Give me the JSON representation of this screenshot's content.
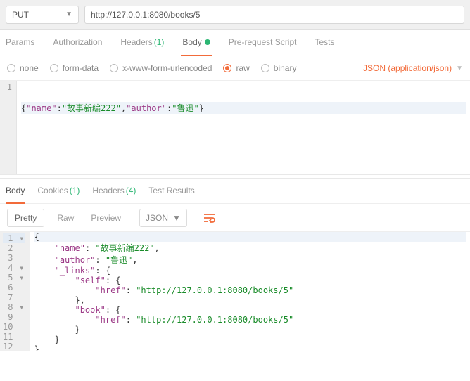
{
  "request": {
    "method": "PUT",
    "url": "http://127.0.0.1:8080/books/5"
  },
  "tabs": {
    "params": "Params",
    "authorization": "Authorization",
    "headers": "Headers",
    "headers_count": "(1)",
    "body": "Body",
    "prerequest": "Pre-request Script",
    "tests": "Tests"
  },
  "body_options": {
    "none": "none",
    "form_data": "form-data",
    "x_www": "x-www-form-urlencoded",
    "raw": "raw",
    "binary": "binary",
    "content_type": "JSON (application/json)"
  },
  "request_body": {
    "line1_gutter": "1",
    "parts": {
      "open": "{",
      "k1": "\"name\"",
      "c1": ":",
      "v1": "\"故事新编222\"",
      "comma": ",",
      "k2": "\"author\"",
      "c2": ":",
      "v2": "\"鲁迅\"",
      "close": "}"
    }
  },
  "response_tabs": {
    "body": "Body",
    "cookies": "Cookies",
    "cookies_count": "(1)",
    "headers": "Headers",
    "headers_count": "(4)",
    "test_results": "Test Results"
  },
  "response_toolbar": {
    "pretty": "Pretty",
    "raw": "Raw",
    "preview": "Preview",
    "format": "JSON"
  },
  "response_body": {
    "lines": [
      {
        "n": "1",
        "fold": "▾",
        "indent": 0,
        "tokens": [
          {
            "t": "p",
            "v": "{"
          }
        ]
      },
      {
        "n": "2",
        "indent": 1,
        "tokens": [
          {
            "t": "k",
            "v": "\"name\""
          },
          {
            "t": "p",
            "v": ": "
          },
          {
            "t": "s",
            "v": "\"故事新编222\""
          },
          {
            "t": "p",
            "v": ","
          }
        ]
      },
      {
        "n": "3",
        "indent": 1,
        "tokens": [
          {
            "t": "k",
            "v": "\"author\""
          },
          {
            "t": "p",
            "v": ": "
          },
          {
            "t": "s",
            "v": "\"鲁迅\""
          },
          {
            "t": "p",
            "v": ","
          }
        ]
      },
      {
        "n": "4",
        "fold": "▾",
        "indent": 1,
        "tokens": [
          {
            "t": "k",
            "v": "\"_links\""
          },
          {
            "t": "p",
            "v": ": {"
          }
        ]
      },
      {
        "n": "5",
        "fold": "▾",
        "indent": 2,
        "tokens": [
          {
            "t": "k",
            "v": "\"self\""
          },
          {
            "t": "p",
            "v": ": {"
          }
        ]
      },
      {
        "n": "6",
        "indent": 3,
        "tokens": [
          {
            "t": "k",
            "v": "\"href\""
          },
          {
            "t": "p",
            "v": ": "
          },
          {
            "t": "s",
            "v": "\"http://127.0.0.1:8080/books/5\""
          }
        ]
      },
      {
        "n": "7",
        "indent": 2,
        "tokens": [
          {
            "t": "p",
            "v": "},"
          }
        ]
      },
      {
        "n": "8",
        "fold": "▾",
        "indent": 2,
        "tokens": [
          {
            "t": "k",
            "v": "\"book\""
          },
          {
            "t": "p",
            "v": ": {"
          }
        ]
      },
      {
        "n": "9",
        "indent": 3,
        "tokens": [
          {
            "t": "k",
            "v": "\"href\""
          },
          {
            "t": "p",
            "v": ": "
          },
          {
            "t": "s",
            "v": "\"http://127.0.0.1:8080/books/5\""
          }
        ]
      },
      {
        "n": "10",
        "indent": 2,
        "tokens": [
          {
            "t": "p",
            "v": "}"
          }
        ]
      },
      {
        "n": "11",
        "indent": 1,
        "tokens": [
          {
            "t": "p",
            "v": "}"
          }
        ]
      },
      {
        "n": "12",
        "indent": 0,
        "tokens": [
          {
            "t": "p",
            "v": "}"
          }
        ]
      }
    ]
  }
}
